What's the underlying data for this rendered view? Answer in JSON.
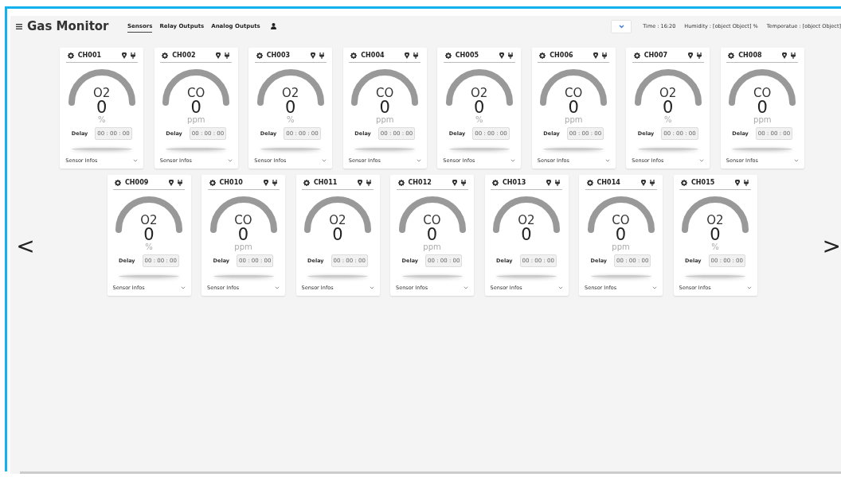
{
  "header": {
    "title": "Gas Monitor",
    "tabs": [
      {
        "label": "Sensors",
        "selected": true
      },
      {
        "label": "Relay Outputs",
        "selected": false
      },
      {
        "label": "Analog Outputs",
        "selected": false
      }
    ],
    "time": "Time : 16:20",
    "humidity": "Humidity : [object Object] %",
    "temperature": "Temperatue : [object Object]"
  },
  "nav": {
    "previous": "<",
    "next": ">"
  },
  "rows": [
    {
      "cards": [
        {
          "channel": "CH001",
          "gas": "O2",
          "value": "0",
          "unit": "%",
          "delay_label": "Delay",
          "delay": "00 : 00 : 00",
          "info_label": "Sensor Infos"
        },
        {
          "channel": "CH002",
          "gas": "CO",
          "value": "0",
          "unit": "ppm",
          "delay_label": "Delay",
          "delay": "00 : 00 : 00",
          "info_label": "Sensor Infos"
        },
        {
          "channel": "CH003",
          "gas": "O2",
          "value": "0",
          "unit": "%",
          "delay_label": "Delay",
          "delay": "00 : 00 : 00",
          "info_label": "Sensor Infos"
        },
        {
          "channel": "CH004",
          "gas": "CO",
          "value": "0",
          "unit": "ppm",
          "delay_label": "Delay",
          "delay": "00 : 00 : 00",
          "info_label": "Sensor Infos"
        },
        {
          "channel": "CH005",
          "gas": "O2",
          "value": "0",
          "unit": "%",
          "delay_label": "Delay",
          "delay": "00 : 00 : 00",
          "info_label": "Sensor Infos"
        },
        {
          "channel": "CH006",
          "gas": "CO",
          "value": "0",
          "unit": "ppm",
          "delay_label": "Delay",
          "delay": "00 : 00 : 00",
          "info_label": "Sensor Infos"
        },
        {
          "channel": "CH007",
          "gas": "O2",
          "value": "0",
          "unit": "%",
          "delay_label": "Delay",
          "delay": "00 : 00 : 00",
          "info_label": "Sensor Infos"
        },
        {
          "channel": "CH008",
          "gas": "CO",
          "value": "0",
          "unit": "ppm",
          "delay_label": "Delay",
          "delay": "00 : 00 : 00",
          "info_label": "Sensor Infos"
        }
      ]
    },
    {
      "cards": [
        {
          "channel": "CH009",
          "gas": "O2",
          "value": "0",
          "unit": "%",
          "delay_label": "Delay",
          "delay": "00 : 00 : 00",
          "info_label": "Sensor Infos"
        },
        {
          "channel": "CH010",
          "gas": "CO",
          "value": "0",
          "unit": "ppm",
          "delay_label": "Delay",
          "delay": "00 : 00 : 00",
          "info_label": "Sensor Infos"
        },
        {
          "channel": "CH011",
          "gas": "O2",
          "value": "0",
          "delay_label": "Delay",
          "delay": "00 : 00 : 00",
          "info_label": "Sensor Infos"
        },
        {
          "channel": "CH012",
          "gas": "CO",
          "value": "0",
          "unit": "ppm",
          "delay_label": "Delay",
          "delay": "00 : 00 : 00",
          "info_label": "Sensor Infos"
        },
        {
          "channel": "CH013",
          "gas": "O2",
          "value": "0",
          "delay_label": "Delay",
          "delay": "00 : 00 : 00",
          "info_label": "Sensor Infos"
        },
        {
          "channel": "CH014",
          "gas": "CO",
          "value": "0",
          "unit": "ppm",
          "delay_label": "Delay",
          "delay": "00 : 00 : 00",
          "info_label": "Sensor Infos"
        },
        {
          "channel": "CH015",
          "gas": "O2",
          "value": "0",
          "unit": "%",
          "delay_label": "Delay",
          "delay": "00 : 00 : 00",
          "info_label": "Sensor Infos"
        }
      ]
    }
  ]
}
